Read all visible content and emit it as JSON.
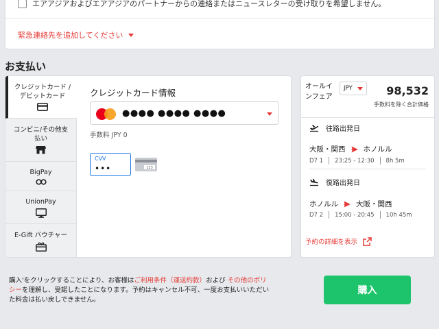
{
  "contact": {
    "newsletter_label": "エアアジアおよびエアアジアのパートナーからの連絡またはニュースレターの受け取りを希望しません。",
    "emergency_contact_label": "緊急連絡先を追加してください"
  },
  "payment": {
    "section_title": "お支払い",
    "tabs": [
      {
        "label": "クレジットカード / デビットカード",
        "icon": "credit-card-icon"
      },
      {
        "label": "コンビニ/その他支払い",
        "icon": "store-icon"
      },
      {
        "label": "BigPay",
        "icon": "bigpay-icon"
      },
      {
        "label": "UnionPay",
        "icon": "monitor-icon"
      },
      {
        "label": "E-Gift バウチャー",
        "icon": "gift-icon"
      }
    ],
    "credit_card": {
      "title": "クレジットカード情報",
      "card_brand_icon": "mastercard-icon",
      "masked_number": "●●●● ●●●● ●●●●",
      "fee": "手数料 JPY 0",
      "cvv_label": "CVV",
      "cvv_value": "•••"
    }
  },
  "summary": {
    "fare_label": "オールインフェア",
    "currency": "JPY",
    "total": "98,532",
    "total_note": "手数料を除く合計価格",
    "legs": [
      {
        "direction": "往路出発日",
        "from": "大阪・関西",
        "to": "ホノルル",
        "flight": "D7 1",
        "time": "23:25 - 12:30",
        "duration": "8h 5m"
      },
      {
        "direction": "復路出発日",
        "from": "ホノルル",
        "to": "大阪・関西",
        "flight": "D7 2",
        "time": "15:00 - 20:45",
        "duration": "10h 45m"
      }
    ],
    "details_link": "予約の詳細を表示"
  },
  "footer": {
    "terms_prefix": "購入'をクリックすることにより、お客様は",
    "terms_link1": "ご利用条件（運送約款）",
    "terms_mid": "および",
    "terms_link2": "その他のポリシー",
    "terms_suffix": "を理解し、受諾したことになります。予約はキャンセル不可、一度お支払いいただいた料金は払い戻しできません。",
    "buy_label": "購入"
  },
  "colors": {
    "accent_red": "#e53935",
    "buy_green": "#1ec46b",
    "focus_blue": "#1a73e8"
  }
}
